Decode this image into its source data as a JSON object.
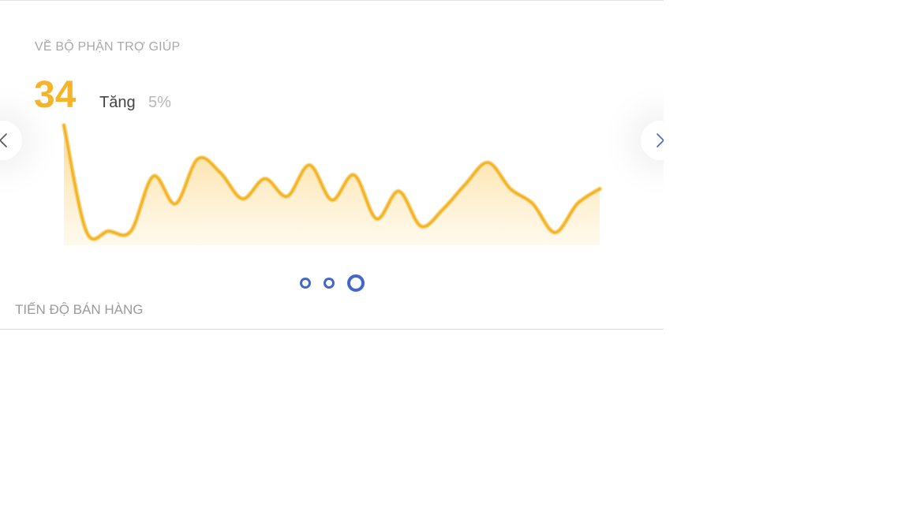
{
  "slide": {
    "title": "VỀ BỘ PHẬN TRỢ GIÚP",
    "value": "34",
    "delta_label": "Tăng",
    "delta_value": "5%"
  },
  "footer": {
    "title": "TIẾN ĐỘ BÁN HÀNG"
  },
  "colors": {
    "accent": "#f5b42a",
    "dot": "#4466cc"
  },
  "icons": {
    "prev": "chevron-left-icon",
    "next": "chevron-right-icon"
  },
  "carousel": {
    "slides": 3,
    "active_index": 2
  },
  "chart_data": {
    "type": "area",
    "values": [
      95,
      10,
      10,
      10,
      54,
      32,
      68,
      57,
      36,
      52,
      38,
      63,
      35,
      55,
      20,
      42,
      14,
      28,
      48,
      65,
      44,
      32,
      9,
      32,
      44
    ]
  }
}
